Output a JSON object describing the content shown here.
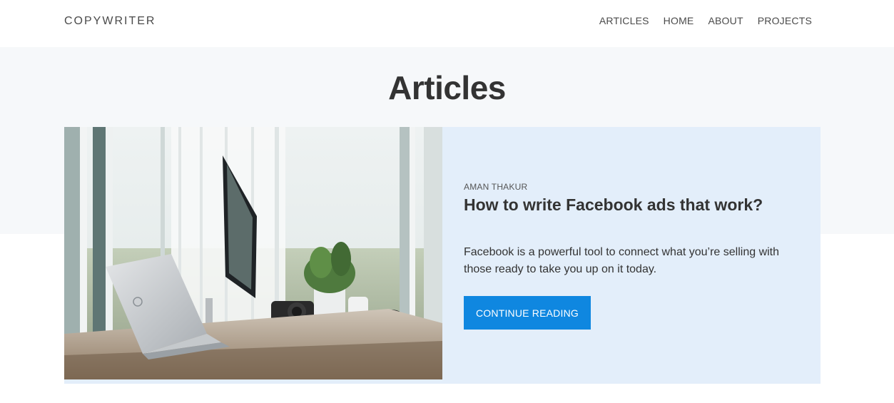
{
  "header": {
    "brand": "COPYWRITER",
    "nav": [
      "ARTICLES",
      "HOME",
      "ABOUT",
      "PROJECTS"
    ]
  },
  "page_title": "Articles",
  "featured_article": {
    "author": "AMAN THAKUR",
    "title": "How to write Facebook ads that work?",
    "excerpt": "Facebook is a powerful tool to connect what you’re selling with those ready to take you up on it today.",
    "cta_label": "CONTINUE READING"
  },
  "colors": {
    "accent": "#0f87e0",
    "card_background": "#e3eefa",
    "hero_background": "#f6f8fa",
    "text": "#333333"
  }
}
